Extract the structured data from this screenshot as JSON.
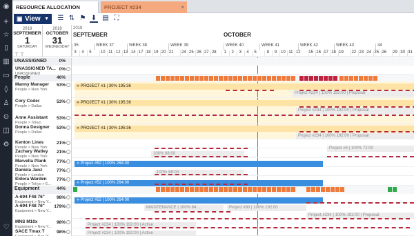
{
  "tabs": [
    {
      "label": "RESOURCE ALLOCATION"
    },
    {
      "label": "PROJECT #234",
      "close": "×"
    }
  ],
  "toolbar": {
    "view_label": "View"
  },
  "date_panel": {
    "left": {
      "year": "2018",
      "month": "SEPTEMBER",
      "day": "1",
      "weekday": "SATURDAY"
    },
    "right": {
      "year": "2018",
      "month": "OCTOBER",
      "day": "31",
      "weekday": "WEDNESDAY"
    }
  },
  "timeline": {
    "year": "2018",
    "months": [
      "SEPTEMBER",
      "OCTOBER"
    ],
    "weeks": [
      "35",
      "WEEK 37",
      "WEEK 38",
      "WEEK 39",
      "WEEK 40",
      "WEEK 41",
      "WEEK 42",
      "WEEK 43",
      "44"
    ],
    "days": [
      "3",
      "4",
      "5",
      "10",
      "11",
      "12",
      "13",
      "14",
      "17",
      "18",
      "19",
      "20",
      "21",
      "24",
      "25",
      "26",
      "27",
      "28",
      "1",
      "2",
      "3",
      "4",
      "5",
      "8",
      "9",
      "10",
      "11",
      "12",
      "15",
      "16",
      "17",
      "18",
      "19",
      "22",
      "23",
      "24",
      "25",
      "26",
      "29",
      "30",
      "31"
    ]
  },
  "rows": [
    {
      "type": "group",
      "name": "UNASSIGNED",
      "pct": "0%"
    },
    {
      "type": "person",
      "name": "UNASSIGNED TA...",
      "sub": "UNASSIGNED",
      "pct": "0%"
    },
    {
      "type": "group",
      "name": "People",
      "pct": "46%"
    },
    {
      "type": "person",
      "name": "Manny Manager",
      "sub": "People > New York",
      "pct": "53%"
    },
    {
      "type": "person",
      "name": "Cory Coder",
      "sub": "People > Dallas",
      "pct": "53%"
    },
    {
      "type": "person",
      "name": "Anne Assistant",
      "sub": "People > Tokyo",
      "pct": "53%"
    },
    {
      "type": "person",
      "name": "Donna Designer",
      "sub": "People > Dallas",
      "pct": "53%"
    },
    {
      "type": "person",
      "name": "Kenton Lines",
      "sub": "People > New York",
      "pct": "21%"
    },
    {
      "type": "person",
      "name": "Zachary Watley",
      "sub": "People > New York",
      "pct": "21%"
    },
    {
      "type": "person",
      "name": "Marvella Plank",
      "sub": "People > New York",
      "pct": "77%"
    },
    {
      "type": "person",
      "name": "Daniela Janz",
      "sub": "People > London",
      "pct": "77%"
    },
    {
      "type": "person",
      "name": "Eldora Warden",
      "sub": "People > Tokyo > E...",
      "pct": "77%"
    },
    {
      "type": "group",
      "name": "Equipment",
      "pct": "44%"
    },
    {
      "type": "person",
      "name": "A-694 F48 76\"",
      "sub": "Equipment > New Y...",
      "pct": "98%"
    },
    {
      "type": "person",
      "name": "A-694 F48 76\"",
      "sub": "Equipment > New Y...",
      "pct": "179%"
    },
    {
      "type": "person",
      "name": "MNS M10x",
      "sub": "Equipment > New Y...",
      "pct": "98%"
    },
    {
      "type": "person",
      "name": "SACE Tmax T",
      "sub": "Equipment > New Y...",
      "pct": "98%"
    }
  ],
  "bars": [
    {
      "name": "bar-manny-project1",
      "label": "PROJECT #1 | 30% 195:36",
      "style": "yel"
    },
    {
      "name": "bar-manny-project234",
      "label": "Project #234 | 100% 192:00 | Proposal",
      "style": "gry"
    },
    {
      "name": "bar-cory-project1",
      "label": "PROJECT #1 | 30% 195:36",
      "style": "yel"
    },
    {
      "name": "bar-anne-project234",
      "label": "Project #234 | 100% 192:00 | Proposal",
      "style": "gry"
    },
    {
      "name": "bar-donna-project1",
      "label": "PROJECT #1 | 30% 195:36",
      "style": "yel"
    },
    {
      "name": "bar-donna-project234",
      "label": "Project #234 | 100% 192:00 | Proposal",
      "style": "gry"
    },
    {
      "name": "bar-kenton-100",
      "label": "100% 88:00",
      "style": "gry"
    },
    {
      "name": "bar-kenton-project6",
      "label": "Project #6 | 100% 72:00",
      "style": "gry"
    },
    {
      "name": "bar-marvella-project52",
      "label": "Project #52 | 100% 264:00",
      "style": "blu"
    },
    {
      "name": "bar-daniela-100",
      "label": "100% 88:00",
      "style": "gry"
    },
    {
      "name": "bar-eldora-project52",
      "label": "Project #52 | 100% 264:00",
      "style": "blu"
    },
    {
      "name": "bar-a694-project52",
      "label": "Project #52 | 100% 264:00",
      "style": "blu"
    },
    {
      "name": "bar-a694b-maint",
      "label": "MAINTENANCE | 100% 84:...",
      "style": "gry"
    },
    {
      "name": "bar-a694b-project90",
      "label": "Project #90 | 100% 192:00",
      "style": "gry"
    },
    {
      "name": "bar-a694b-project234",
      "label": "Project #234 | 100% 192:00 | Proposal",
      "style": "gry"
    },
    {
      "name": "bar-mns-project234",
      "label": "Project #234 | 100% 192:00 | Active",
      "style": "gry"
    },
    {
      "name": "bar-sace-project234",
      "label": "Project #234 | 100% 192:00 | Active",
      "style": "gry"
    }
  ],
  "colors": {
    "heat_orange": "#ef7a3a",
    "heat_red": "#c0213c",
    "heat_green": "#2eaa4c",
    "dash": "#b52a3c",
    "today": "#e0404a"
  }
}
